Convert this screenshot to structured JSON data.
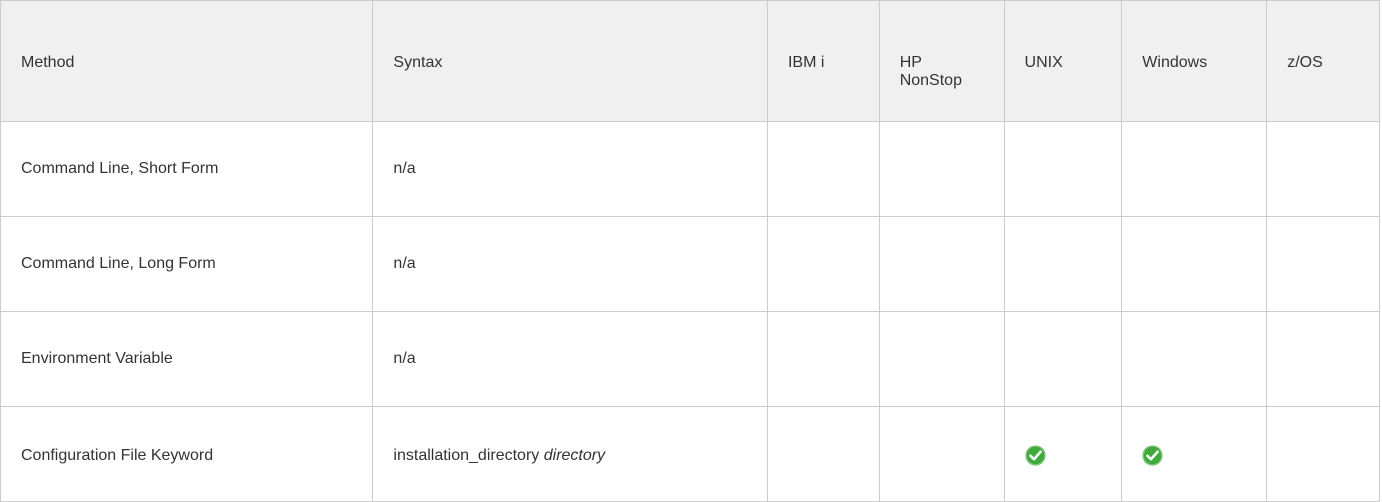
{
  "table": {
    "headers": [
      "Method",
      "Syntax",
      "IBM i",
      "HP NonStop",
      "UNIX",
      "Windows",
      "z/OS"
    ],
    "rows": [
      {
        "method": "Command Line, Short Form",
        "syntax": "n/a"
      },
      {
        "method": "Command Line, Long Form",
        "syntax": "n/a"
      },
      {
        "method": "Environment Variable",
        "syntax": "n/a"
      },
      {
        "method": "Configuration File Keyword",
        "syntax": "installation_directory",
        "syntax_arg": "directory",
        "supported": [
          "UNIX",
          "Windows"
        ]
      }
    ]
  },
  "icons": {
    "supported": "check-circle-icon"
  },
  "colors": {
    "header_bg": "#f0f0f0",
    "border": "#cccccc",
    "text": "#333333",
    "check_green": "#3fa93b"
  }
}
